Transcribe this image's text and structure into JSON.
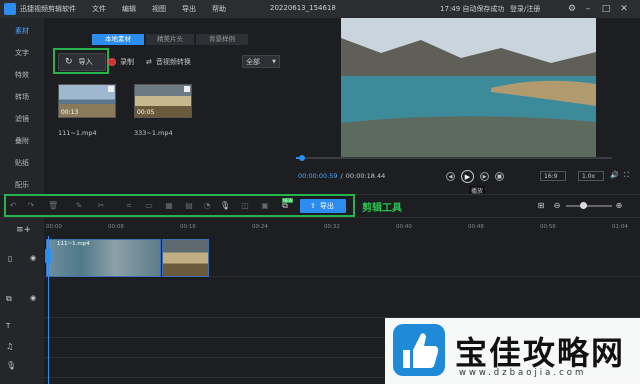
{
  "titlebar": {
    "app_name": "迅捷视频剪辑软件",
    "menus": [
      "文件",
      "编辑",
      "视图",
      "导出",
      "帮助"
    ],
    "project_name": "20220613_154618",
    "save_status": "17:49 自动保存成功",
    "login": "登录/注册"
  },
  "sidebar": {
    "items": [
      "素材",
      "文字",
      "特效",
      "转场",
      "滤镜",
      "叠附",
      "贴纸",
      "配乐"
    ],
    "active_index": 0
  },
  "media": {
    "tabs": [
      "本地素材",
      "精美片头",
      "背景样例"
    ],
    "import_label": "导入",
    "record_label": "录制",
    "convert_label": "音视频转换",
    "filter_value": "全部",
    "items": [
      {
        "name": "111~1.mp4",
        "duration": "00:13"
      },
      {
        "name": "333~1.mp4",
        "duration": "00:05"
      }
    ]
  },
  "preview": {
    "current_time": "00:00:00.59",
    "total_time": "00:00:18.44",
    "play_tooltip": "播放",
    "aspect_ratio": "16:9",
    "speed": "1.0x"
  },
  "toolbar": {
    "export_label": "导出",
    "badge": "NEW",
    "annotation": "剪辑工具"
  },
  "timeline": {
    "ticks": [
      "00:00",
      "00:08",
      "00:16",
      "00:24",
      "00:32",
      "00:40",
      "00:48",
      "00:56",
      "01:04"
    ],
    "clip_label": "111~1.mp4"
  },
  "watermark": {
    "text": "宝佳攻略网",
    "url": "www.dzbaojia.com"
  },
  "colors": {
    "accent": "#2d8cf0",
    "highlight": "#27b34b"
  }
}
